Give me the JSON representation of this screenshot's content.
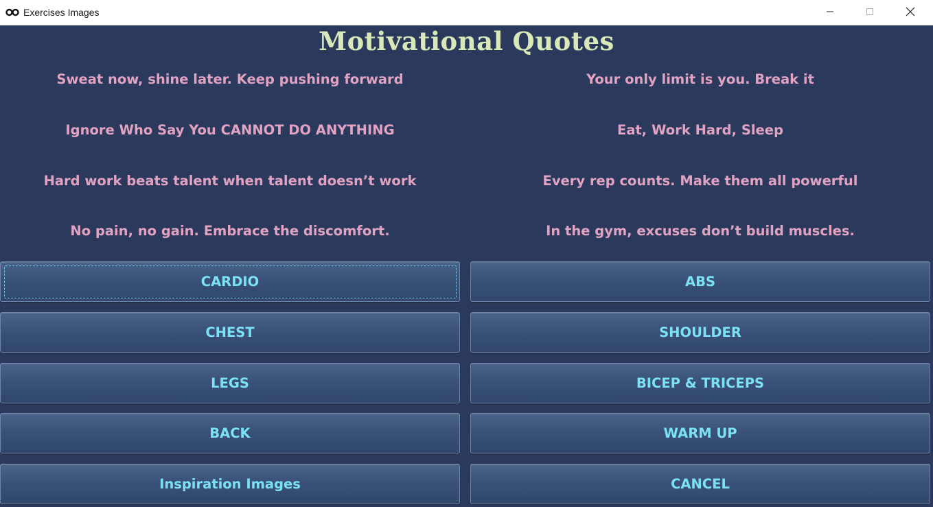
{
  "window": {
    "title": "Exercises Images",
    "app_icon": "app-logo-icon",
    "controls": {
      "minimize_icon": "minimize-icon",
      "maximize_icon": "maximize-icon",
      "close_icon": "close-icon"
    }
  },
  "heading": "Motivational Quotes",
  "quotes": {
    "left": [
      "Sweat now, shine later. Keep pushing forward",
      "Ignore Who Say You CANNOT DO ANYTHING",
      "Hard work beats talent when talent doesn’t work",
      "No pain, no gain. Embrace the discomfort."
    ],
    "right": [
      "Your only limit is you. Break it",
      "Eat, Work Hard, Sleep",
      "Every rep counts. Make them all powerful",
      "In the gym, excuses don’t build muscles."
    ]
  },
  "buttons": {
    "cardio": "CARDIO",
    "abs": "ABS",
    "chest": "CHEST",
    "shoulder": "SHOULDER",
    "legs": "LEGS",
    "bicep_triceps": "BICEP & TRICEPS",
    "back": "BACK",
    "warm_up": "WARM UP",
    "inspiration_images": "Inspiration Images",
    "cancel": "CANCEL"
  },
  "focused_button": "cardio",
  "colors": {
    "background": "#2b3a5c",
    "heading": "#d8e8b8",
    "quote_text": "#e2a3c3",
    "button_text": "#7be1f5"
  }
}
